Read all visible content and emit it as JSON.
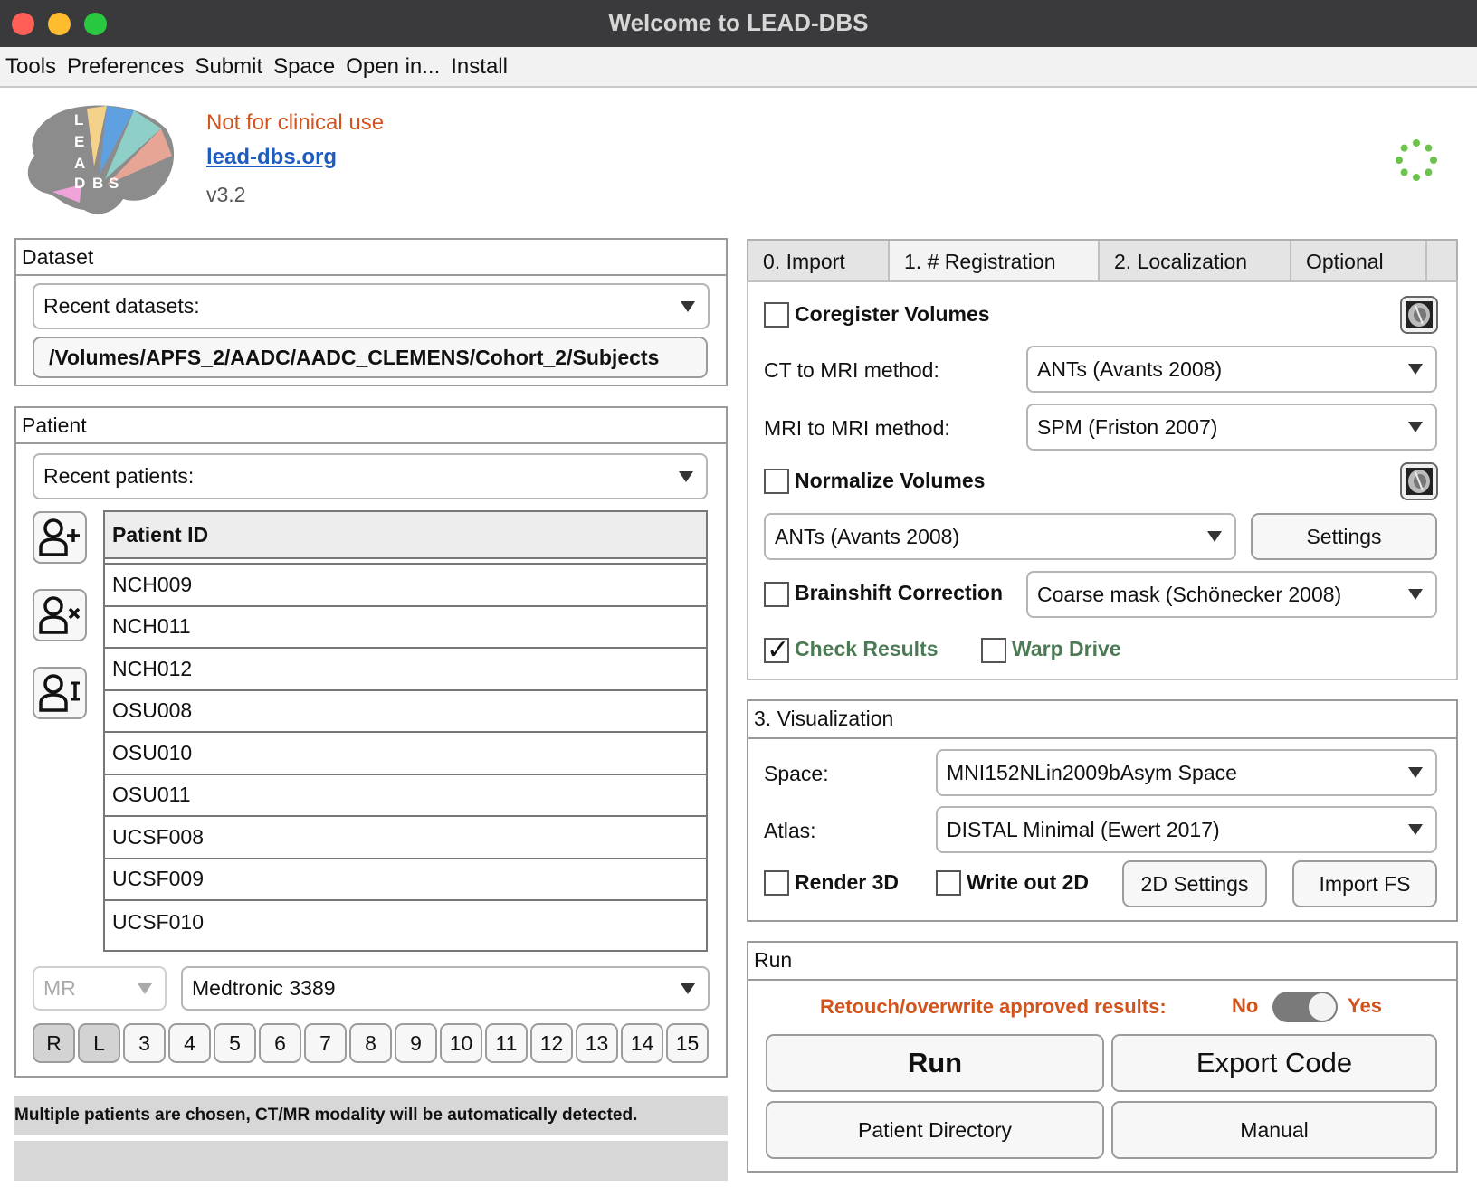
{
  "window": {
    "title": "Welcome to LEAD-DBS"
  },
  "menu": [
    "Tools",
    "Preferences",
    "Submit",
    "Space",
    "Open in...",
    "Install"
  ],
  "header": {
    "logo_letters": [
      "L",
      "E",
      "A",
      "D",
      "B",
      "S"
    ],
    "warning": "Not for clinical use",
    "website": "lead-dbs.org",
    "version": "v3.2"
  },
  "dataset": {
    "title": "Dataset",
    "recent_label": "Recent datasets:",
    "path": "/Volumes/APFS_2/AADC/AADC_CLEMENS/Cohort_2/Subjects"
  },
  "patient": {
    "title": "Patient",
    "recent_label": "Recent patients:",
    "column_header": "Patient ID",
    "rows": [
      {
        "id": "NCH009",
        "selected": false
      },
      {
        "id": "NCH011",
        "selected": false
      },
      {
        "id": "NCH012",
        "selected": false
      },
      {
        "id": "OSU008",
        "selected": false
      },
      {
        "id": "OSU010",
        "selected": false
      },
      {
        "id": "OSU011",
        "selected": true
      },
      {
        "id": "UCSF008",
        "selected": true
      },
      {
        "id": "UCSF009",
        "selected": true
      },
      {
        "id": "UCSF010",
        "selected": true
      }
    ],
    "modality": "MR",
    "electrode": "Medtronic 3389",
    "contacts": [
      "R",
      "L",
      "3",
      "4",
      "5",
      "6",
      "7",
      "8",
      "9",
      "10",
      "11",
      "12",
      "13",
      "14",
      "15"
    ],
    "status_message": "Multiple patients are chosen, CT/MR modality will be automatically detected.",
    "progress": 0
  },
  "tabs": [
    "0. Import",
    "1. # Registration",
    "2. Localization",
    "Optional"
  ],
  "active_tab": "1. # Registration",
  "registration": {
    "coregister_label": "Coregister Volumes",
    "coregister_checked": false,
    "ct_mri_label": "CT to MRI method:",
    "ct_mri_value": "ANTs (Avants 2008)",
    "mri_mri_label": "MRI to MRI method:",
    "mri_mri_value": "SPM (Friston 2007)",
    "normalize_label": "Normalize Volumes",
    "normalize_checked": false,
    "normalize_method": "ANTs (Avants 2008)",
    "settings_label": "Settings",
    "brainshift_label": "Brainshift Correction",
    "brainshift_checked": false,
    "brainshift_method": "Coarse mask (Schönecker 2008)",
    "check_results_label": "Check Results",
    "check_results_checked": true,
    "warp_drive_label": "Warp Drive",
    "warp_drive_checked": false
  },
  "visualization": {
    "title": "3. Visualization",
    "space_label": "Space:",
    "space_value": "MNI152NLin2009bAsym Space",
    "atlas_label": "Atlas:",
    "atlas_value": "DISTAL Minimal (Ewert 2017)",
    "render3d_label": "Render 3D",
    "writeout2d_label": "Write out 2D",
    "settings2d_label": "2D Settings",
    "importfs_label": "Import FS"
  },
  "run": {
    "title": "Run",
    "retouch_label": "Retouch/overwrite approved results:",
    "no_label": "No",
    "yes_label": "Yes",
    "toggle_state": "Yes",
    "run_label": "Run",
    "export_label": "Export Code",
    "patient_dir_label": "Patient Directory",
    "manual_label": "Manual"
  },
  "colors": {
    "accent_orange": "#d2531c",
    "link_blue": "#1f5cc0",
    "check_green": "#4c7a55",
    "spinner_green": "#6cc24a"
  }
}
